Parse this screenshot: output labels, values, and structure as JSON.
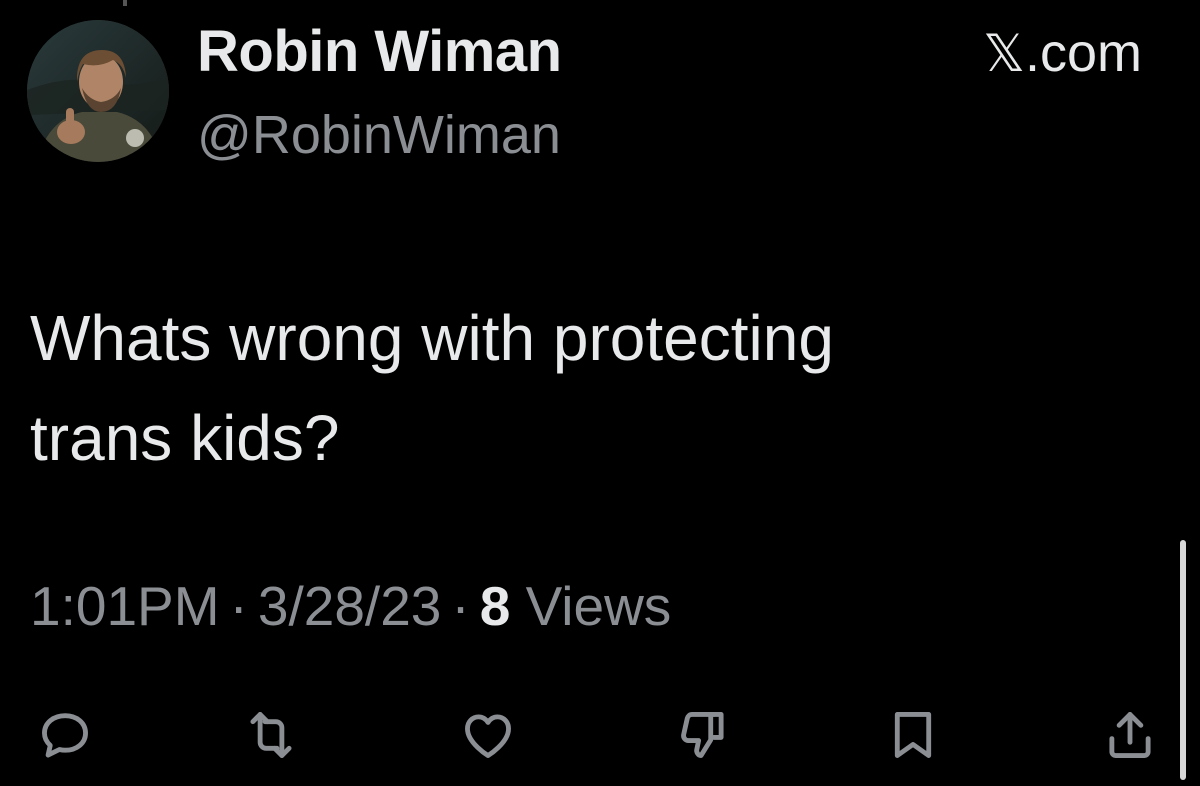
{
  "author": {
    "display_name": "Robin Wiman",
    "handle": "@RobinWiman",
    "avatar_icon": "user-avatar-photo"
  },
  "brand": {
    "label": ".com",
    "logo_icon": "x-logo-icon"
  },
  "tweet": {
    "text_line_1": "Whats wrong with protecting",
    "text_line_2": "trans kids?"
  },
  "meta": {
    "time": "1:01PM",
    "separator": "·",
    "date": "3/28/23",
    "views_count": "8",
    "views_label": "Views"
  },
  "actions": [
    {
      "name": "reply",
      "icon": "reply-icon"
    },
    {
      "name": "retweet",
      "icon": "retweet-icon"
    },
    {
      "name": "like",
      "icon": "heart-icon"
    },
    {
      "name": "dislike",
      "icon": "thumbs-down-icon"
    },
    {
      "name": "bookmark",
      "icon": "bookmark-icon"
    },
    {
      "name": "share",
      "icon": "share-icon"
    }
  ],
  "colors": {
    "background": "#000000",
    "primary_text": "#e7e9ea",
    "secondary_text": "#8b8f94",
    "icon": "#8b8f94"
  }
}
